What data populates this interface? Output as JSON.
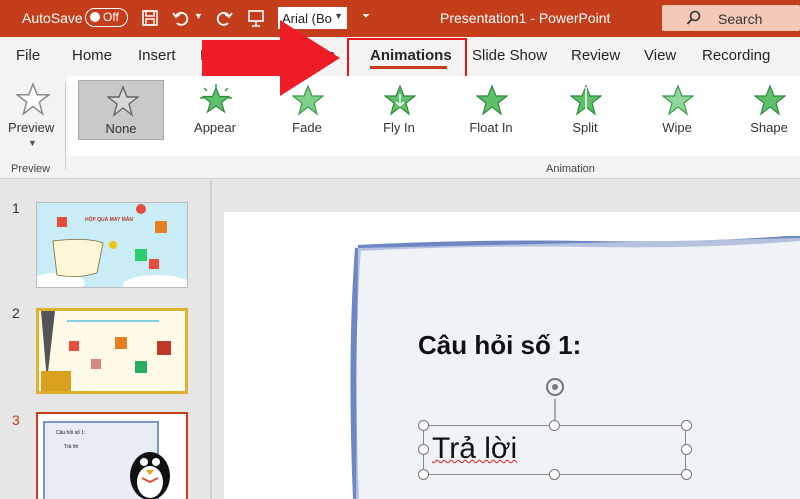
{
  "titlebar": {
    "autosave_label": "AutoSave",
    "autosave_state": "Off",
    "font_name": "Arial (Bo",
    "doc_title": "Presentation1  -  PowerPoint",
    "search_label": "Search"
  },
  "tabs": {
    "file": "File",
    "home": "Home",
    "insert": "Insert",
    "design": "D",
    "transitions": "itions",
    "animations": "Animations",
    "slideshow": "Slide Show",
    "review": "Review",
    "view": "View",
    "recording": "Recording",
    "active_color": "#c43e1c"
  },
  "ribbon": {
    "preview_label": "Preview",
    "preview_group": "Preview",
    "animation_group": "Animation",
    "animations": [
      {
        "label": "None",
        "icon": "star-outline-icon",
        "selected": true
      },
      {
        "label": "Appear",
        "icon": "star-burst-icon"
      },
      {
        "label": "Fade",
        "icon": "star-green-icon"
      },
      {
        "label": "Fly In",
        "icon": "star-green-icon"
      },
      {
        "label": "Float In",
        "icon": "star-green-icon"
      },
      {
        "label": "Split",
        "icon": "star-green-icon"
      },
      {
        "label": "Wipe",
        "icon": "star-green-icon"
      },
      {
        "label": "Shape",
        "icon": "star-green-icon"
      }
    ]
  },
  "slides": [
    {
      "number": "1",
      "title": "HỘP QUÀ MAY MẮN"
    },
    {
      "number": "2"
    },
    {
      "number": "3",
      "active": true,
      "title": "Câu hỏi số 1:",
      "subtitle": "Trả lời"
    }
  ],
  "slide": {
    "question": "Câu hỏi số 1:",
    "answer": "Trả lời"
  }
}
